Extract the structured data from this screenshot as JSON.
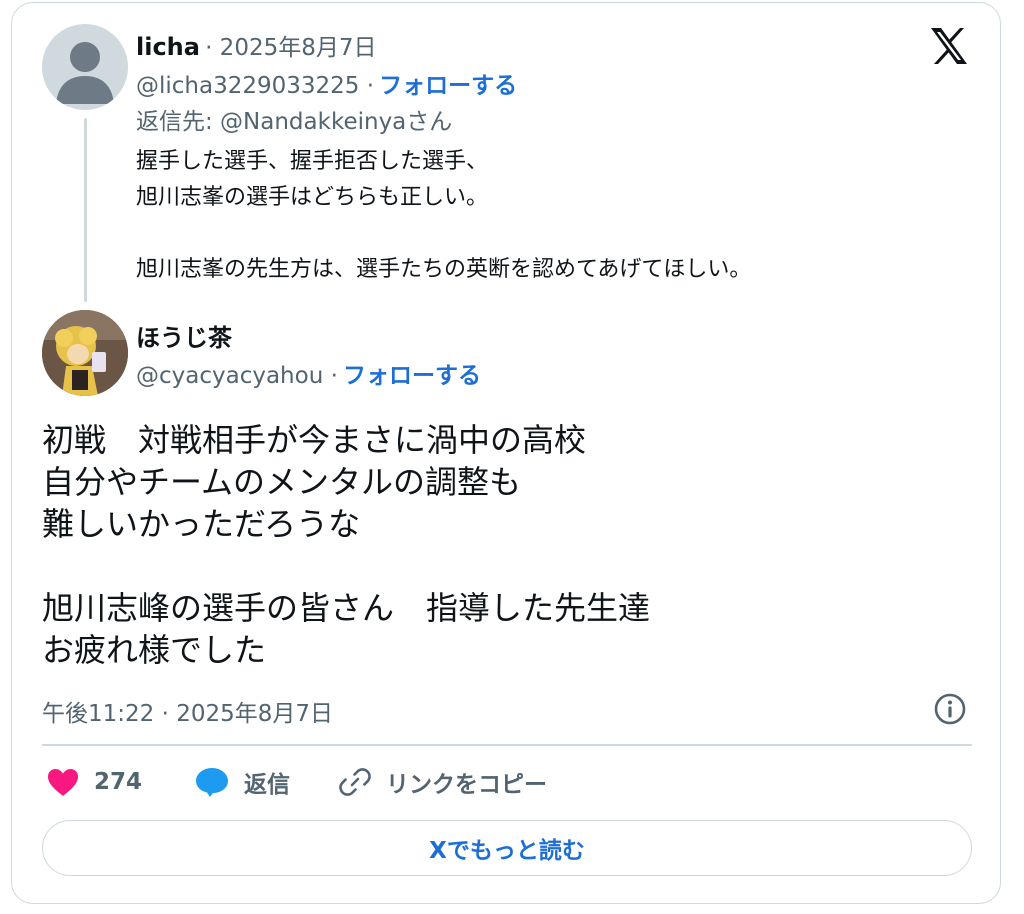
{
  "reply_tweet": {
    "display_name": "licha",
    "date": "· 2025年8月7日",
    "handle": "@licha3229033225 ·",
    "follow_label": "フォローする",
    "replying_to": "返信先: @Nandakkeinyaさん",
    "lines": [
      "握手した選手、握手拒否した選手、",
      "旭川志峯の選手はどちらも正しい。",
      "",
      "旭川志峯の先生方は、選手たちの英断を認めてあげてほしい。"
    ]
  },
  "main_tweet": {
    "display_name": "ほうじ茶",
    "handle": "@cyacyacyahou ·",
    "follow_label": "フォローする",
    "lines": [
      "初戦　対戦相手が今まさに渦中の高校",
      "自分やチームのメンタルの調整も",
      "難しいかっただろうな",
      "",
      "旭川志峰の選手の皆さん　指導した先生達",
      "お疲れ様でした"
    ],
    "timestamp": "午後11:22 · 2025年8月7日"
  },
  "actions": {
    "like_count": "274",
    "reply_label": "返信",
    "copy_link_label": "リンクをコピー"
  },
  "read_more_label": "Xでもっと読む",
  "colors": {
    "accent": "#1d6fd6",
    "like": "#f91880",
    "reply_bubble": "#1d9bf0",
    "muted": "#536471",
    "border": "#cfd9de"
  },
  "icons": [
    "x-logo-icon",
    "default-avatar-icon",
    "heart-icon",
    "reply-bubble-icon",
    "link-icon",
    "info-icon"
  ]
}
